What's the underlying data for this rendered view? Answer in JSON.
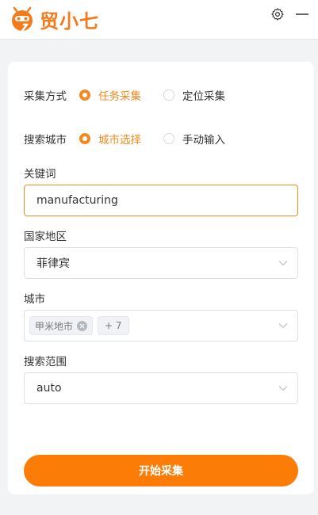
{
  "app": {
    "name": "贸小七",
    "brand_color": "#f37b1d",
    "accent_color": "#fb7d08"
  },
  "topbar": {
    "settings_icon": "gear-icon",
    "minimize_icon": "minimize-icon"
  },
  "form": {
    "collect_mode": {
      "label": "采集方式",
      "options": [
        {
          "label": "任务采集",
          "selected": true
        },
        {
          "label": "定位采集",
          "selected": false
        }
      ]
    },
    "search_city": {
      "label": "搜索城市",
      "options": [
        {
          "label": "城市选择",
          "selected": true
        },
        {
          "label": "手动输入",
          "selected": false
        }
      ]
    },
    "keyword": {
      "label": "关键词",
      "value": "manufacturing"
    },
    "country": {
      "label": "国家地区",
      "value": "菲律宾"
    },
    "city": {
      "label": "城市",
      "tags": [
        "甲米地市"
      ],
      "more": "+ 7"
    },
    "range": {
      "label": "搜索范围",
      "value": "auto"
    },
    "submit_label": "开始采集"
  }
}
